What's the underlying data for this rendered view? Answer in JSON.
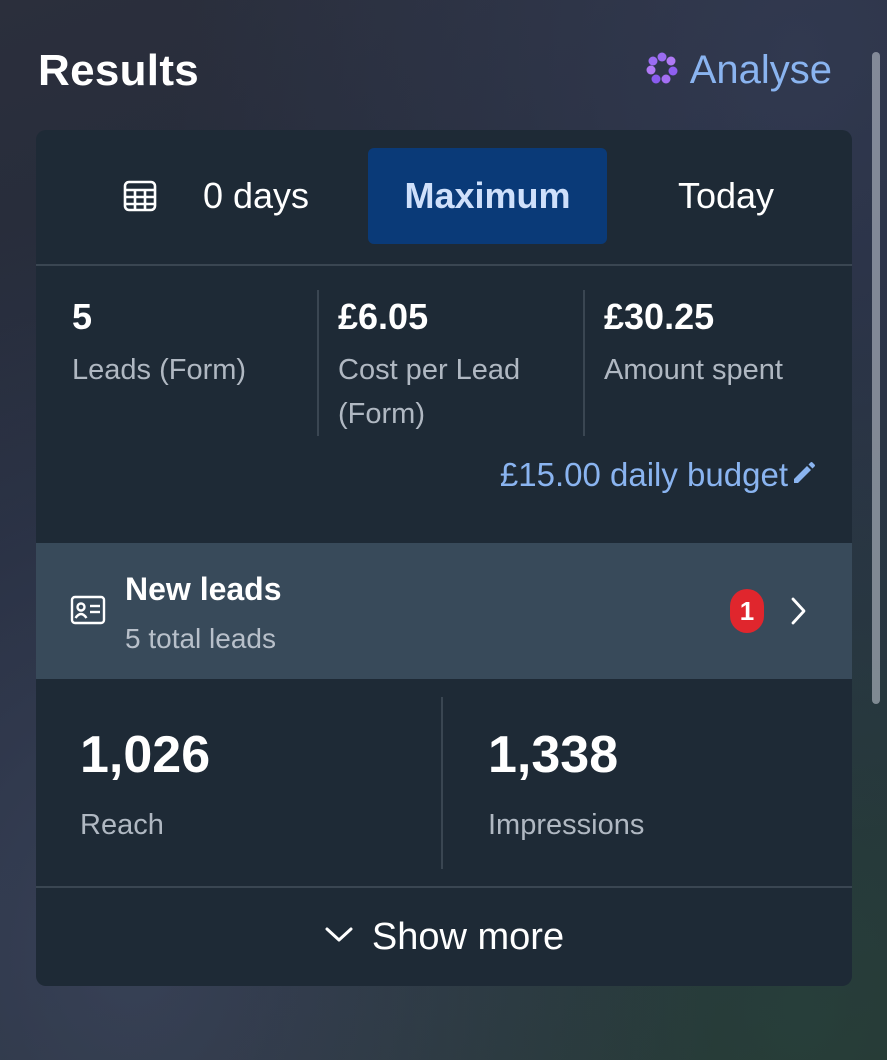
{
  "header": {
    "title": "Results",
    "analyse_label": "Analyse"
  },
  "tabs": [
    {
      "label": "0 days",
      "icon": "calendar-icon",
      "selected": false
    },
    {
      "label": "Maximum",
      "selected": true
    },
    {
      "label": "Today",
      "selected": false
    }
  ],
  "stats": [
    {
      "value": "5",
      "label": "Leads (Form)"
    },
    {
      "value": "£6.05",
      "label": "Cost per Lead (Form)"
    },
    {
      "value": "£30.25",
      "label": "Amount spent"
    }
  ],
  "budget": {
    "label": "£15.00 daily budget",
    "icon": "pencil-icon"
  },
  "leads": {
    "icon": "contact-card-icon",
    "title": "New leads",
    "subtitle": "5 total leads",
    "badge": "1"
  },
  "metrics": [
    {
      "value": "1,026",
      "label": "Reach"
    },
    {
      "value": "1,338",
      "label": "Impressions"
    }
  ],
  "show_more": {
    "label": "Show more",
    "icon": "chevron-down-icon"
  },
  "colors": {
    "accent": "#8ab4f0",
    "card": "#1e2a36",
    "selected_tab": "#0a3a78",
    "leads_row": "#384a5a",
    "badge": "#e0262d"
  }
}
